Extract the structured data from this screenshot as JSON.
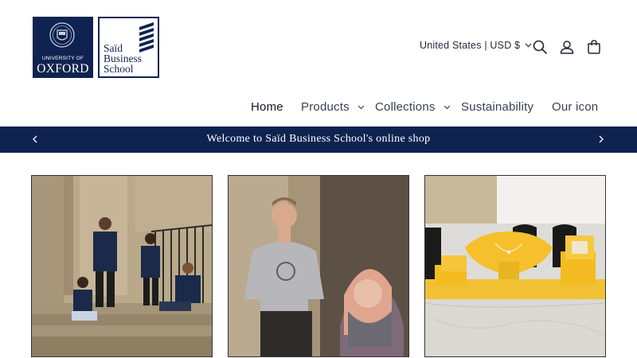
{
  "brand": {
    "oxford_small": "UNIVERSITY OF",
    "oxford_name": "OXFORD",
    "said_line1": "Saïd",
    "said_line2": "Business",
    "said_line3": "School",
    "navy": "#0f2350"
  },
  "header": {
    "locale_label": "United States | USD $",
    "icons": [
      "search-icon",
      "account-icon",
      "cart-icon"
    ]
  },
  "nav": {
    "items": [
      {
        "label": "Home",
        "active": true
      },
      {
        "label": "Products",
        "has_dropdown": true
      },
      {
        "label": "Collections",
        "has_dropdown": true
      },
      {
        "label": "Sustainability"
      },
      {
        "label": "Our icon"
      }
    ]
  },
  "announcement": {
    "message": "Welcome to Saïd Business School's online shop"
  },
  "cards": [
    {
      "subject": "group-on-steps-photo"
    },
    {
      "subject": "tshirt-models-photo"
    },
    {
      "subject": "jewellery-display-photo"
    }
  ]
}
